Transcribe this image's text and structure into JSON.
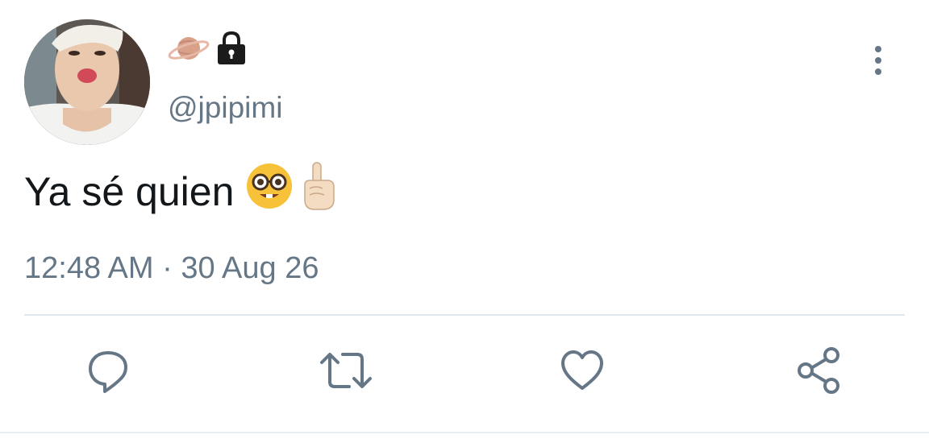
{
  "tweet": {
    "name_icons": [
      "planet-icon",
      "lock-icon"
    ],
    "handle": "@jpipimi",
    "text": "Ya sé quien",
    "text_emojis": [
      "nerd-face-emoji",
      "pointing-up-emoji"
    ],
    "timestamp": "12:48 AM · 30 Aug 26"
  },
  "actions": {
    "reply_icon": "speech-bubble-icon",
    "retweet_icon": "retweet-icon",
    "like_icon": "heart-icon",
    "share_icon": "share-icon",
    "more_icon": "vertical-dots-icon"
  },
  "colors": {
    "text": "#14171a",
    "secondary": "#657786",
    "divider": "#e1e8ed"
  }
}
